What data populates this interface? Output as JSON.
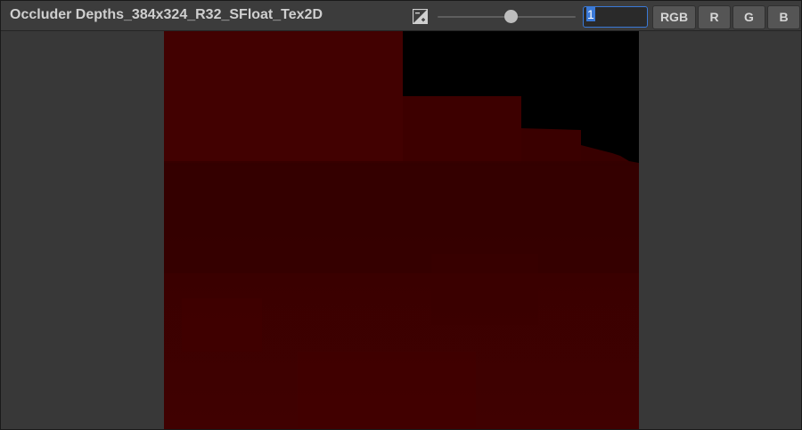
{
  "window": {
    "title": "Occluder Depths_384x324_R32_SFloat_Tex2D"
  },
  "toolbar": {
    "exposure_icon": "exposure-icon",
    "exposure_slider": {
      "value_fraction": 0.53
    },
    "exposure_value": "1",
    "channels": [
      "RGB",
      "R",
      "G",
      "B"
    ]
  },
  "preview": {
    "content": "depth texture preview",
    "colors": {
      "depth_red": "#3f0101",
      "empty_black": "#000000"
    }
  }
}
